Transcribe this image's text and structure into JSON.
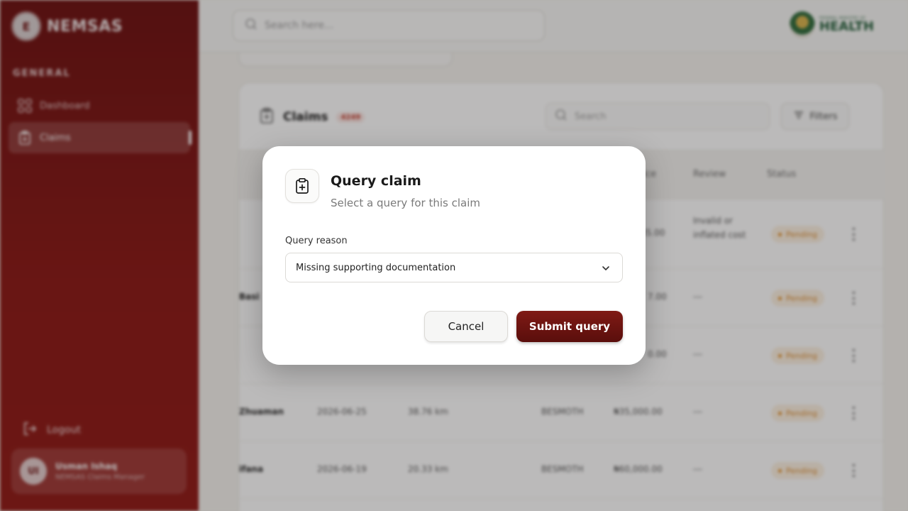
{
  "app": {
    "brand_name": "NEMSAS",
    "brand_logo_text": "E",
    "partner_logo_small": "FEDERAL MINISTRY OF",
    "partner_logo_large": "HEALTH"
  },
  "sidebar": {
    "section_label": "GENERAL",
    "items": [
      {
        "label": "Dashboard",
        "icon": "grid-icon",
        "active": false
      },
      {
        "label": "Claims",
        "icon": "clipboard-icon",
        "active": true
      }
    ],
    "logout_label": "Logout",
    "user": {
      "initials": "UI",
      "name": "Usman Ishaq",
      "role": "NEMSAS Claims Manager"
    }
  },
  "topbar": {
    "search_placeholder": "Search here..."
  },
  "claims": {
    "title": "Claims",
    "count": "4249",
    "search_placeholder": "Search",
    "filters_label": "Filters",
    "columns": [
      "rice",
      "Review",
      "Status"
    ],
    "rows": [
      {
        "name": "",
        "date": "",
        "distance": "",
        "provider": "",
        "price": "45.00",
        "review": "Invalid or inflated cost",
        "status": "Pending"
      },
      {
        "name": "Basi",
        "date": "",
        "distance": "",
        "provider": "",
        "price": "7.00",
        "review": "---",
        "status": "Pending"
      },
      {
        "name": "",
        "date": "",
        "distance": "",
        "provider": "",
        "price": "0.00",
        "review": "---",
        "status": "Pending"
      },
      {
        "name": "Zhuaman",
        "date": "2026-06-25",
        "distance": "38.76 km",
        "provider": "BESMOTH",
        "price": "₦35,000.00",
        "review": "---",
        "status": "Pending"
      },
      {
        "name": "ifana",
        "date": "2026-06-19",
        "distance": "20.33 km",
        "provider": "BESMOTH",
        "price": "₦60,000.00",
        "review": "---",
        "status": "Pending"
      }
    ]
  },
  "modal": {
    "title": "Query claim",
    "subtitle": "Select a query for this claim",
    "field_label": "Query reason",
    "selected_reason": "Missing supporting documentation",
    "cancel_label": "Cancel",
    "submit_label": "Submit query",
    "accent_color": "#6b1210"
  }
}
